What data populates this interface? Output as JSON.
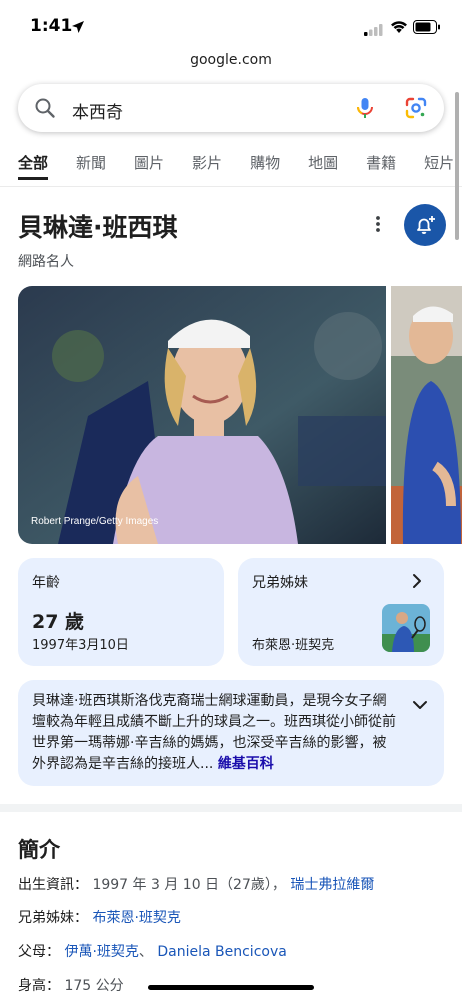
{
  "status_bar": {
    "time": "1:41"
  },
  "browser": {
    "url": "google.com"
  },
  "search": {
    "query": "本西奇"
  },
  "tabs": [
    {
      "label": "全部",
      "active": true
    },
    {
      "label": "新聞"
    },
    {
      "label": "圖片"
    },
    {
      "label": "影片"
    },
    {
      "label": "購物"
    },
    {
      "label": "地圖"
    },
    {
      "label": "書籍"
    },
    {
      "label": "短片"
    }
  ],
  "entity": {
    "title": "貝琳達·班西琪",
    "subtitle": "網路名人"
  },
  "images": {
    "credit": "Robert Prange/Getty Images"
  },
  "age_card": {
    "label": "年齡",
    "value": "27 歲",
    "date": "1997年3月10日"
  },
  "sibling_card": {
    "label": "兄弟姊妹",
    "name": "布萊恩·班契克"
  },
  "description": {
    "text": "貝琳達·班西琪斯洛伐克裔瑞士網球運動員，是現今女子網壇較為年輕且成績不斷上升的球員之一。班西琪從小師從前世界第一瑪蒂娜·辛吉絲的媽媽，也深受辛吉絲的影響，被外界認為是辛吉絲的接班人...",
    "source": "維基百科"
  },
  "about": {
    "title": "簡介",
    "birth": {
      "label": "出生資訊：",
      "value": "1997 年 3 月 10 日（27歲），",
      "place": "瑞士弗拉維爾"
    },
    "siblings": {
      "label": "兄弟姊妹：",
      "link": "布萊恩·班契克"
    },
    "parents": {
      "label": "父母：",
      "link1": "伊萬·班契克",
      "sep": "、",
      "link2": "Daniela Bencicova"
    },
    "height": {
      "label": "身高：",
      "value": "175 公分"
    }
  },
  "colors": {
    "accent_blue": "#1a56a8",
    "card_bg": "#e8f0fe",
    "link": "#1a0dab"
  }
}
